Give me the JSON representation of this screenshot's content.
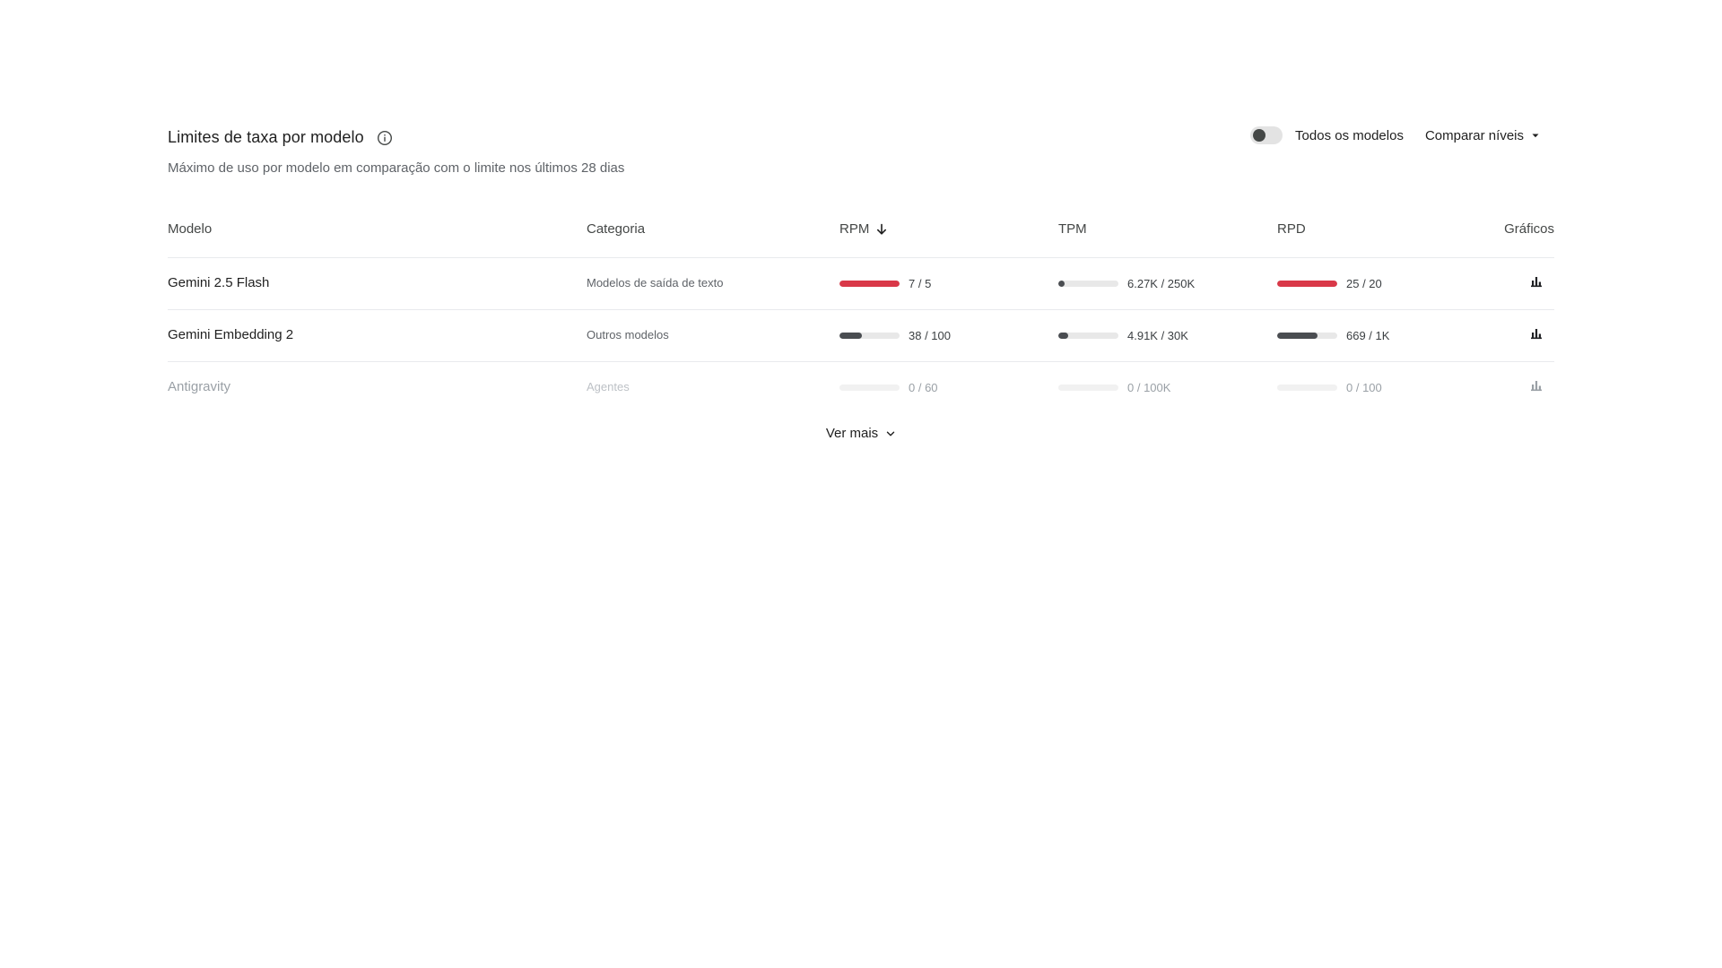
{
  "header": {
    "title": "Limites de taxa por modelo",
    "subtitle": "Máximo de uso por modelo em comparação com o limite nos últimos 28 dias",
    "toggle_label": "Todos os modelos",
    "toggle_on": false,
    "compare_label": "Comparar níveis"
  },
  "table": {
    "columns": {
      "model": "Modelo",
      "category": "Categoria",
      "rpm": "RPM",
      "tpm": "TPM",
      "rpd": "RPD",
      "charts": "Gráficos"
    },
    "rows": [
      {
        "model": "Gemini 2.5 Flash",
        "category": "Modelos de saída de texto",
        "rpm": {
          "label": "7 / 5",
          "fraction": 1.0,
          "status": "over"
        },
        "tpm": {
          "label": "6.27K / 250K",
          "fraction": 0.025,
          "status": "normal"
        },
        "rpd": {
          "label": "25 / 20",
          "fraction": 1.0,
          "status": "over"
        },
        "dim": false
      },
      {
        "model": "Gemini Embedding 2",
        "category": "Outros modelos",
        "rpm": {
          "label": "38 / 100",
          "fraction": 0.38,
          "status": "normal"
        },
        "tpm": {
          "label": "4.91K / 30K",
          "fraction": 0.16,
          "status": "normal"
        },
        "rpd": {
          "label": "669 / 1K",
          "fraction": 0.669,
          "status": "normal"
        },
        "dim": false
      },
      {
        "model": "Antigravity",
        "category": "Agentes",
        "rpm": {
          "label": "0 / 60",
          "fraction": 0,
          "status": "normal"
        },
        "tpm": {
          "label": "0 / 100K",
          "fraction": 0,
          "status": "normal"
        },
        "rpd": {
          "label": "0 / 100",
          "fraction": 0,
          "status": "normal"
        },
        "dim": true
      }
    ]
  },
  "footer": {
    "see_more_label": "Ver mais"
  },
  "colors": {
    "over": "#d93848",
    "normal": "#4a4d51"
  },
  "icons": {
    "info": "info-circle-icon",
    "sort": "arrow-down-icon",
    "chart": "bar-chart-icon",
    "dropdown": "caret-down-icon",
    "expand": "chevron-down-icon"
  }
}
